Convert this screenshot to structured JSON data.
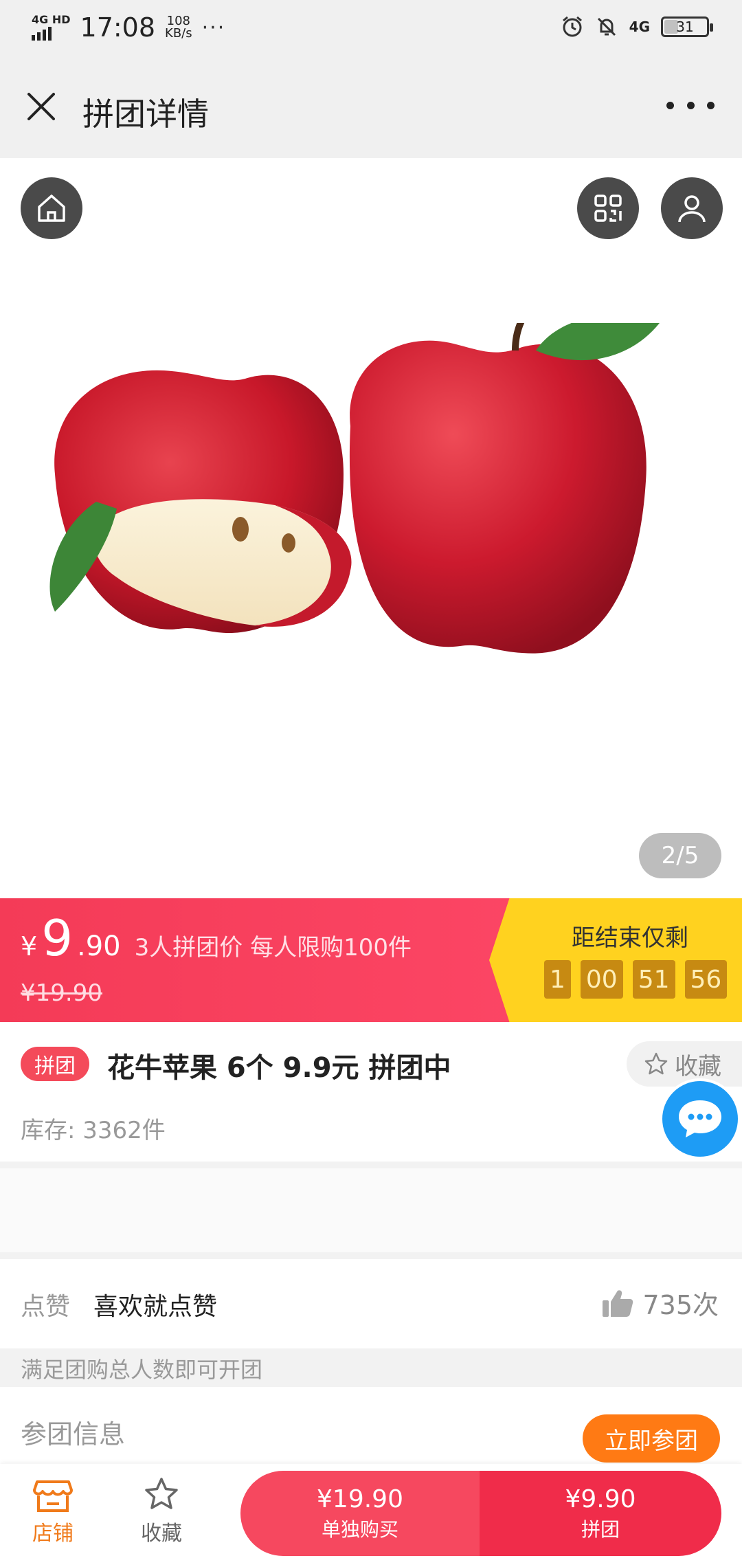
{
  "status": {
    "network": "4G HD",
    "time": "17:08",
    "speed_value": "108",
    "speed_unit": "KB/s",
    "more": "···",
    "net_right": "4G",
    "battery": "31"
  },
  "nav": {
    "title": "拼团详情"
  },
  "hero": {
    "pager": "2/5"
  },
  "price": {
    "yen": "¥",
    "integer": "9",
    "decimal": ".90",
    "desc": "3人拼团价 每人限购100件",
    "original": "¥19.90",
    "battery_level": 0.31
  },
  "countdown": {
    "label": "距结束仅剩",
    "days": "1",
    "hours": "00",
    "minutes": "51",
    "seconds": "56"
  },
  "product": {
    "tag": "拼团",
    "title": "花牛苹果 6个 9.9元 拼团中",
    "favorite": "收藏",
    "stock": "库存: 3362件"
  },
  "like": {
    "label": "点赞",
    "text": "喜欢就点赞",
    "count": "735次"
  },
  "notice": "满足团购总人数即可开团",
  "join": {
    "label": "参团信息",
    "button": "立即参团"
  },
  "bottom": {
    "shop": "店铺",
    "favorite": "收藏",
    "single_price": "¥19.90",
    "single_label": "单独购买",
    "group_price": "¥9.90",
    "group_label": "拼团"
  },
  "colors": {
    "brand_red": "#f43b57",
    "countdown_yellow": "#ffd21f",
    "orange": "#ff7a14",
    "chat_blue": "#1e9cf5"
  }
}
